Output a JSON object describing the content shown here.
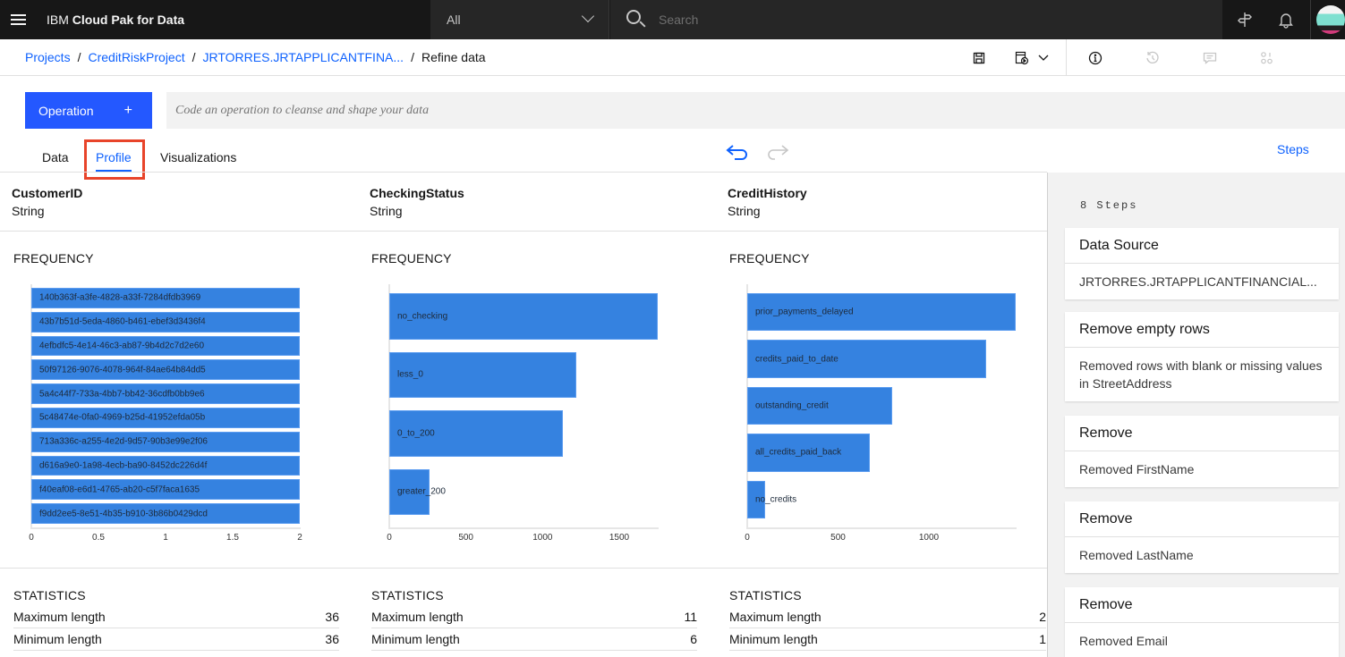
{
  "topbar": {
    "brand_prefix": "IBM",
    "brand_name": "Cloud Pak for Data",
    "scope_value": "All",
    "search_placeholder": "Search"
  },
  "breadcrumb": [
    {
      "label": "Projects",
      "link": true
    },
    {
      "label": "CreditRiskProject",
      "link": true
    },
    {
      "label": "JRTORRES.JRTAPPLICANTFINA...",
      "link": true
    },
    {
      "label": "Refine data",
      "link": false
    }
  ],
  "operation": {
    "button_label": "Operation",
    "button_icon": "+",
    "code_placeholder": "Code an operation to cleanse and shape your data"
  },
  "tabs": [
    {
      "label": "Data",
      "active": false
    },
    {
      "label": "Profile",
      "active": true
    },
    {
      "label": "Visualizations",
      "active": false
    }
  ],
  "steps_link": "Steps",
  "columns": [
    {
      "name": "CustomerID",
      "type": "String",
      "frequency_label": "FREQUENCY",
      "statistics_label": "STATISTICS",
      "stats": [
        {
          "label": "Maximum length",
          "value": "36"
        },
        {
          "label": "Minimum length",
          "value": "36"
        }
      ]
    },
    {
      "name": "CheckingStatus",
      "type": "String",
      "frequency_label": "FREQUENCY",
      "statistics_label": "STATISTICS",
      "stats": [
        {
          "label": "Maximum length",
          "value": "11"
        },
        {
          "label": "Minimum length",
          "value": "6"
        }
      ]
    },
    {
      "name": "CreditHistory",
      "type": "String",
      "frequency_label": "FREQUENCY",
      "statistics_label": "STATISTICS",
      "stats": [
        {
          "label": "Maximum length",
          "value": "2"
        },
        {
          "label": "Minimum length",
          "value": "1"
        }
      ]
    }
  ],
  "chart_data": [
    {
      "type": "bar",
      "orientation": "horizontal",
      "title": "FREQUENCY",
      "column": "CustomerID",
      "categories": [
        "140b363f-a3fe-4828-a33f-7284dfdb3969",
        "43b7b51d-5eda-4860-b461-ebef3d3436f4",
        "4efbdfc5-4e14-46c3-ab87-9b4d2c7d2e60",
        "50f97126-9076-4078-964f-84ae64b84dd5",
        "5a4c44f7-733a-4bb7-bb42-36cdfb0bb9e6",
        "5c48474e-0fa0-4969-b25d-41952efda05b",
        "713a336c-a255-4e2d-9d57-90b3e99e2f06",
        "d616a9e0-1a98-4ecb-ba90-8452dc226d4f",
        "f40eaf08-e6d1-4765-ab20-c5f7faca1635",
        "f9dd2ee5-8e51-4b35-b910-3b86b0429dcd"
      ],
      "values": [
        2,
        2,
        2,
        2,
        2,
        2,
        2,
        2,
        2,
        2
      ],
      "xlim": [
        0,
        2
      ],
      "xticks": [
        "0",
        "0.5",
        "1",
        "1.5",
        "2"
      ]
    },
    {
      "type": "bar",
      "orientation": "horizontal",
      "title": "FREQUENCY",
      "column": "CheckingStatus",
      "categories": [
        "no_checking",
        "less_0",
        "0_to_200",
        "greater_200"
      ],
      "values": [
        1751,
        1220,
        1133,
        263
      ],
      "xlim": [
        0,
        1751
      ],
      "xticks": [
        "0",
        "500",
        "1000",
        "1500"
      ]
    },
    {
      "type": "bar",
      "orientation": "horizontal",
      "title": "FREQUENCY",
      "column": "CreditHistory",
      "categories": [
        "prior_payments_delayed",
        "credits_paid_to_date",
        "outstanding_credit",
        "all_credits_paid_back",
        "no_credits"
      ],
      "values": [
        1478,
        1315,
        798,
        675,
        98
      ],
      "xlim": [
        0,
        1478
      ],
      "xticks": [
        "0",
        "500",
        "1000"
      ]
    }
  ],
  "steps_panel": {
    "count_label": "8 Steps",
    "steps": [
      {
        "title": "Data Source",
        "desc": "JRTORRES.JRTAPPLICANTFINANCIAL..."
      },
      {
        "title": "Remove empty rows",
        "desc": "Removed rows with blank or missing values in StreetAddress"
      },
      {
        "title": "Remove",
        "desc": "Removed FirstName"
      },
      {
        "title": "Remove",
        "desc": "Removed LastName"
      },
      {
        "title": "Remove",
        "desc": "Removed Email"
      }
    ]
  }
}
